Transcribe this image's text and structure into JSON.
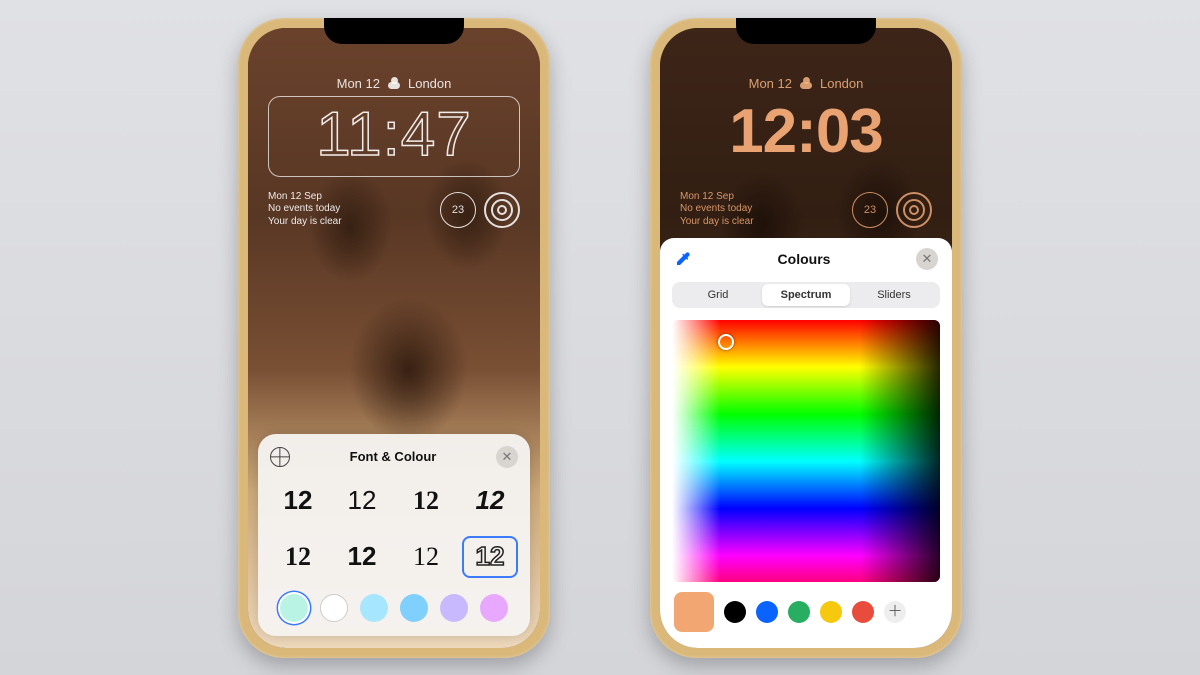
{
  "left": {
    "date_line": {
      "day": "Mon 12",
      "location": "London"
    },
    "clock": "11:47",
    "widgets": {
      "cal_date": "Mon 12 Sep",
      "cal_line1": "No events today",
      "cal_line2": "Your day is clear",
      "temp": "23"
    },
    "sheet": {
      "title": "Font & Colour",
      "font_sample": "12",
      "swatches": [
        "#b9f3e4",
        "#ffffff",
        "#a7e6ff",
        "#7fcfff",
        "#c8b9ff",
        "#e8a8ff"
      ],
      "selected_swatch": 0,
      "selected_font": 7
    }
  },
  "right": {
    "date_line": {
      "day": "Mon 12",
      "location": "London"
    },
    "clock": "12:03",
    "widgets": {
      "cal_date": "Mon 12 Sep",
      "cal_line1": "No events today",
      "cal_line2": "Your day is clear",
      "temp": "23"
    },
    "panel": {
      "title": "Colours",
      "tabs": [
        "Grid",
        "Spectrum",
        "Sliders"
      ],
      "active_tab": 1,
      "current": "#f2a773",
      "presets": [
        "#000000",
        "#0a63ff",
        "#27ae60",
        "#f6c90e",
        "#e74c3c"
      ]
    }
  }
}
